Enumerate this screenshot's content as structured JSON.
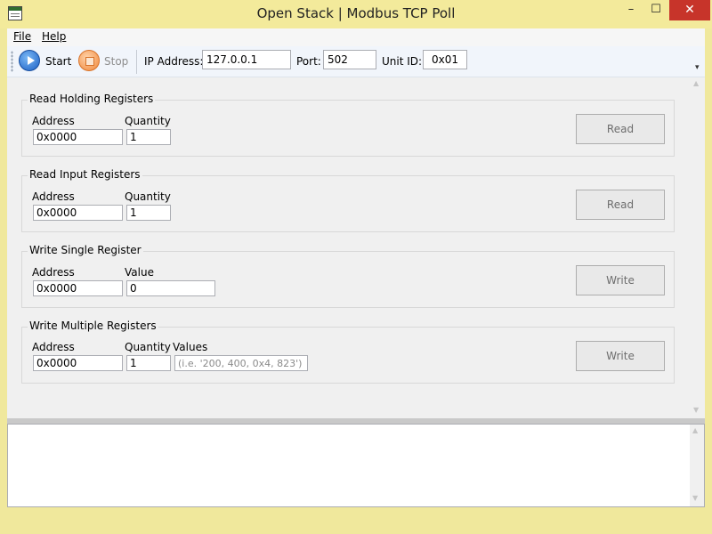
{
  "window": {
    "title": "Open Stack | Modbus TCP Poll",
    "minimize": "–",
    "maximize": "☐",
    "close": "✕"
  },
  "menu": {
    "file": "File",
    "help": "Help"
  },
  "toolbar": {
    "start_label": "Start",
    "stop_label": "Stop",
    "ip_label": "IP Address:",
    "ip_value": "127.0.0.1",
    "port_label": "Port:",
    "port_value": "502",
    "unit_label": "Unit ID:",
    "unit_value": "0x01"
  },
  "groups": [
    {
      "title": "Read Holding Registers",
      "address_label": "Address",
      "address_value": "0x0000",
      "field2_label": "Quantity",
      "field2_value": "1",
      "button": "Read"
    },
    {
      "title": "Read Input Registers",
      "address_label": "Address",
      "address_value": "0x0000",
      "field2_label": "Quantity",
      "field2_value": "1",
      "button": "Read"
    },
    {
      "title": "Write Single Register",
      "address_label": "Address",
      "address_value": "0x0000",
      "field2_label": "Value",
      "field2_value": "0",
      "button": "Write"
    },
    {
      "title": "Write Multiple Registers",
      "address_label": "Address",
      "address_value": "0x0000",
      "field2_label": "Quantity",
      "field2_value": "1",
      "values_label": "Values",
      "values_placeholder": "(i.e. '200, 400, 0x4, 823')",
      "button": "Write"
    }
  ],
  "icons": {
    "app": "app-window-icon",
    "start": "play-icon",
    "stop": "stop-icon"
  }
}
